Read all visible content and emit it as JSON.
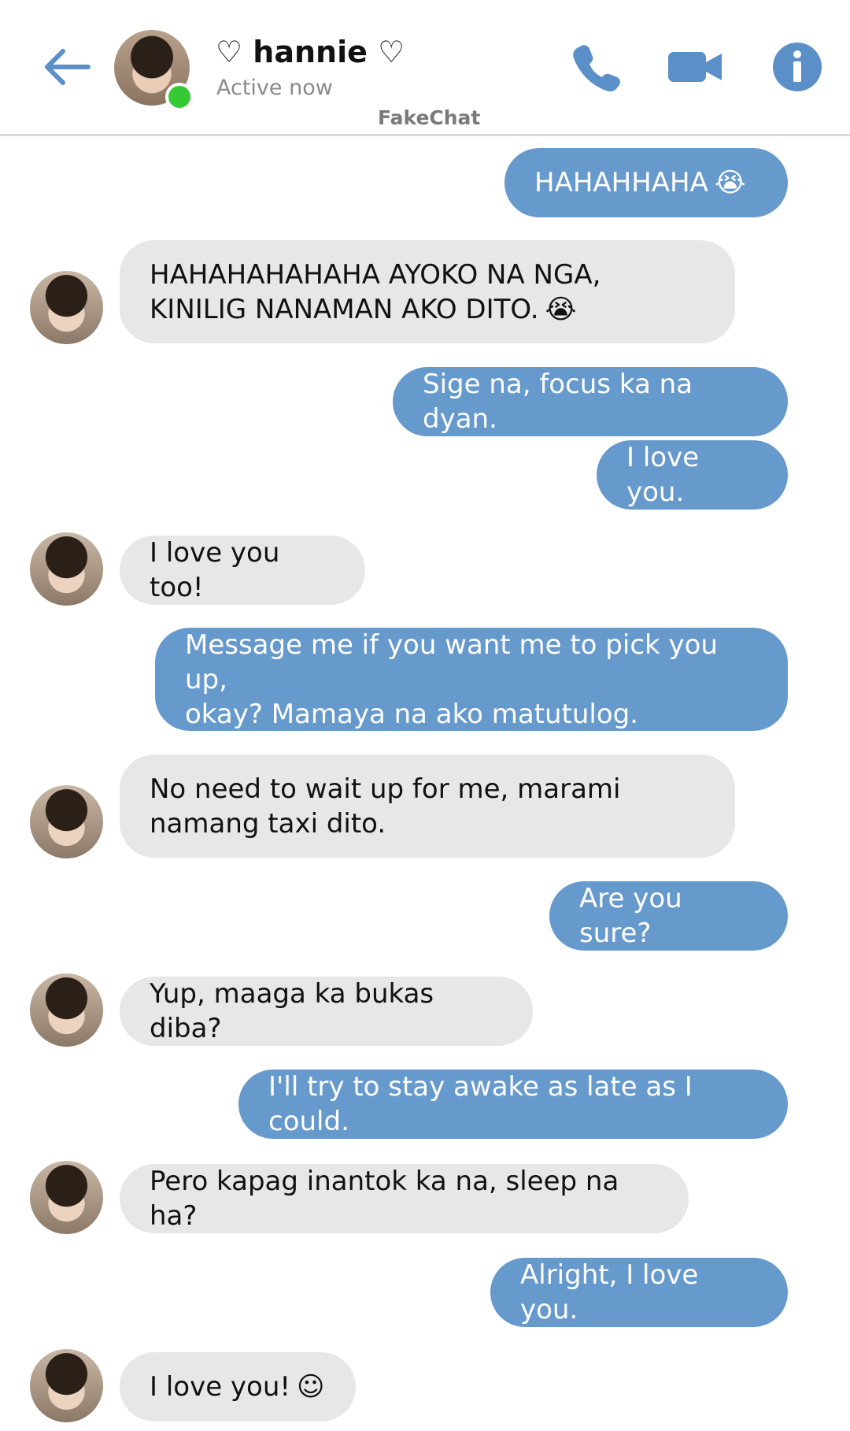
{
  "header": {
    "contact_name": "♡ hannie ♡",
    "status": "Active now",
    "watermark": "FakeChat",
    "online_color": "#35c934",
    "accent_color": "#5b8fc7",
    "icons": [
      "back-arrow-icon",
      "phone-icon",
      "video-camera-icon",
      "info-icon"
    ]
  },
  "messages": [
    {
      "from": "me",
      "text": "HAHAHHAHA",
      "emoji": "😭"
    },
    {
      "from": "them",
      "text": "HAHAHAHAHAHA AYOKO NA NGA,\nKINILIG NANAMAN AKO DITO.",
      "emoji": "😭"
    },
    {
      "from": "me",
      "text": "Sige na, focus ka na dyan."
    },
    {
      "from": "me",
      "text": "I love you."
    },
    {
      "from": "them",
      "text": "I love you too!"
    },
    {
      "from": "me",
      "text": "Message me if you want me to pick you up,\nokay? Mamaya na ako matutulog."
    },
    {
      "from": "them",
      "text": "No need to wait up for me, marami\nnamang taxi dito."
    },
    {
      "from": "me",
      "text": "Are you sure?"
    },
    {
      "from": "them",
      "text": "Yup, maaga ka bukas diba?"
    },
    {
      "from": "me",
      "text": "I'll try to stay awake as late as I could."
    },
    {
      "from": "them",
      "text": "Pero kapag inantok ka na, sleep na ha?"
    },
    {
      "from": "me",
      "text": "Alright, I love you."
    },
    {
      "from": "them",
      "text": "I love you!",
      "emoji": "☺"
    }
  ],
  "colors": {
    "outgoing_bubble": "#6699cc",
    "incoming_bubble": "#e7e7e7"
  }
}
